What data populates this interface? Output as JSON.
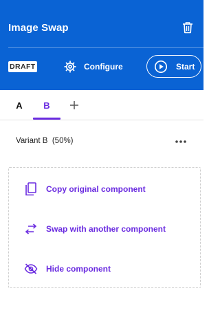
{
  "header": {
    "title": "Image Swap",
    "status_badge": "DRAFT",
    "configure_label": "Configure",
    "start_label": "Start",
    "icons": {
      "delete": "trash-icon",
      "configure": "gear-icon",
      "start": "play-circle-icon"
    },
    "background_color": "#0a63d4"
  },
  "tabs": {
    "items": [
      {
        "label": "A",
        "active": false
      },
      {
        "label": "B",
        "active": true
      }
    ],
    "add_icon": "plus-icon",
    "accent_color": "#6a2be0"
  },
  "variant": {
    "label": "Variant B  (50%)",
    "menu_icon": "more-horizontal-icon"
  },
  "actions": [
    {
      "label": "Copy original component",
      "icon": "copy-icon"
    },
    {
      "label": "Swap with another component",
      "icon": "swap-arrows-icon"
    },
    {
      "label": "Hide component",
      "icon": "eye-off-icon"
    }
  ]
}
